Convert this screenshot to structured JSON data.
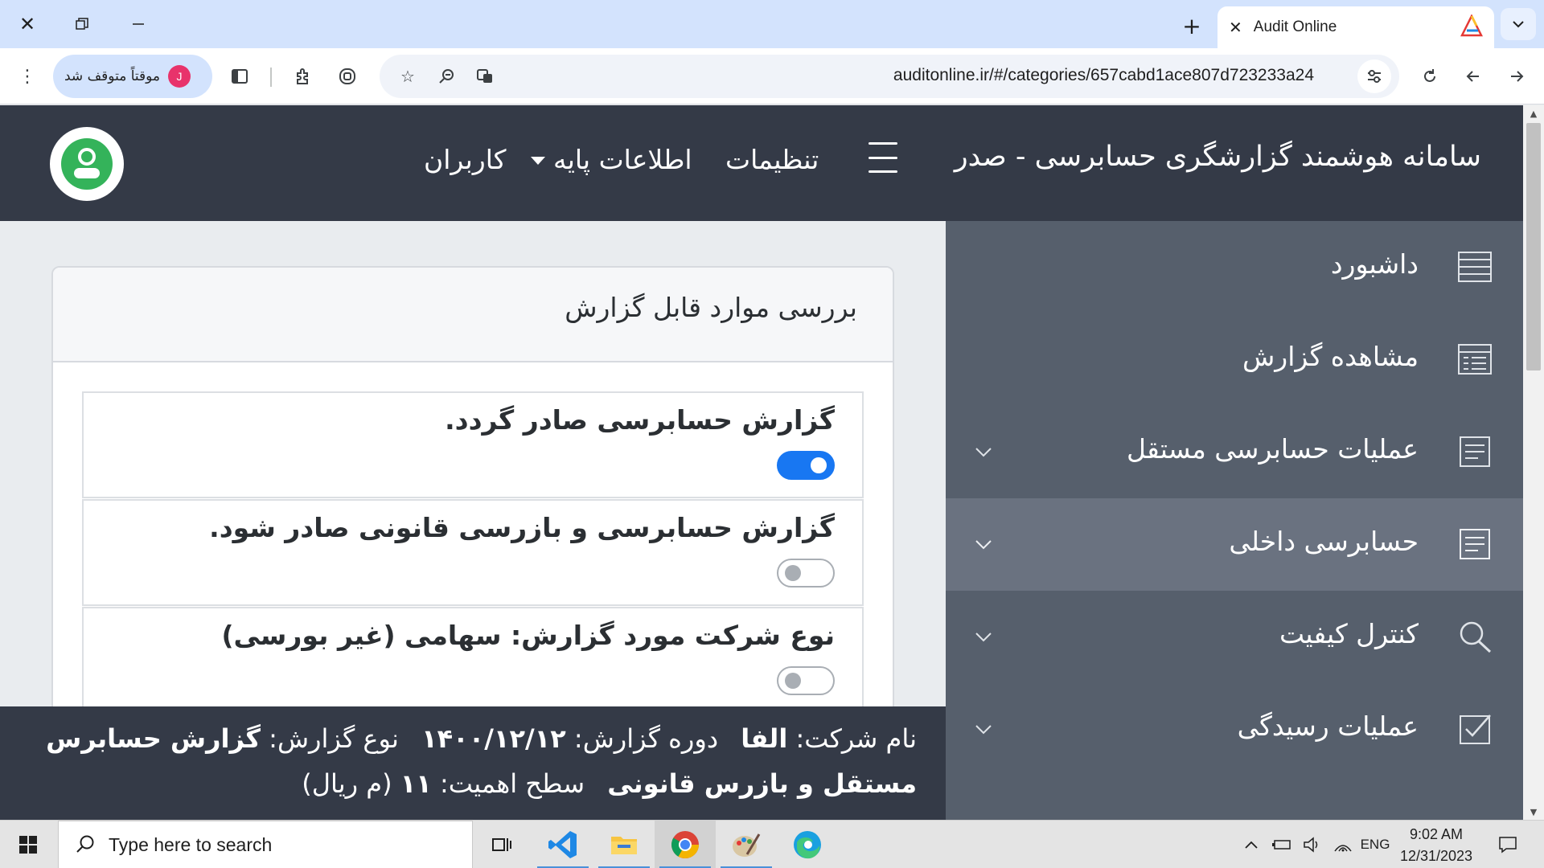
{
  "browser": {
    "tab_title": "Audit Online",
    "url": "auditonline.ir/#/categories/657cabd1ace807d723233a24",
    "profile_initial": "J",
    "profile_status": "موقتاً متوقف شد",
    "colors": {
      "tabbar": "#d3e3fd",
      "toolbar": "#ffffff"
    }
  },
  "app": {
    "title": "سامانه هوشمند گزارشگری حسابرسی - صدر",
    "nav": {
      "settings": "تنظیمات",
      "base_info": "اطلاعات پایه",
      "users": "کاربران"
    },
    "colors": {
      "header": "#343a47",
      "sidebar": "#565f6c",
      "sidebar_active": "#6a7280",
      "toggle_on": "#1877f2"
    }
  },
  "sidebar": {
    "items": [
      {
        "label": "داشبورد",
        "icon": "dashboard-list-icon"
      },
      {
        "label": "مشاهده گزارش",
        "icon": "report-grid-icon"
      },
      {
        "label": "عملیات حسابرسی مستقل",
        "icon": "document-lines-icon"
      },
      {
        "label": "حسابرسی داخلی",
        "icon": "document-lines-icon"
      },
      {
        "label": "کنترل کیفیت",
        "icon": "magnifier-icon"
      },
      {
        "label": "عملیات رسیدگی",
        "icon": "checkbox-icon"
      }
    ]
  },
  "card": {
    "title": "بررسی موارد قابل گزارش",
    "options": [
      {
        "label": "گزارش حسابرسی صادر گردد.",
        "checked": true
      },
      {
        "label": "گزارش حسابرسی و بازرسی قانونی صادر شود.",
        "checked": false
      },
      {
        "label": "نوع شرکت مورد گزارش: سهامی (غیر بورسی)",
        "checked": false
      }
    ]
  },
  "footer": {
    "company_label": "نام شرکت:",
    "company_value": "الفا",
    "period_label": "دوره گزارش:",
    "period_value": "۱۴۰۰/۱۲/۱۲",
    "type_label": "نوع گزارش:",
    "type_value": "گزارش حسابرس مستقل و بازرس قانونی",
    "materiality_label": "سطح اهمیت:",
    "materiality_value": "۱۱",
    "materiality_unit": "(م ریال)"
  },
  "taskbar": {
    "search_placeholder": "Type here to search",
    "language": "ENG",
    "time": "9:02 AM",
    "date": "12/31/2023"
  }
}
